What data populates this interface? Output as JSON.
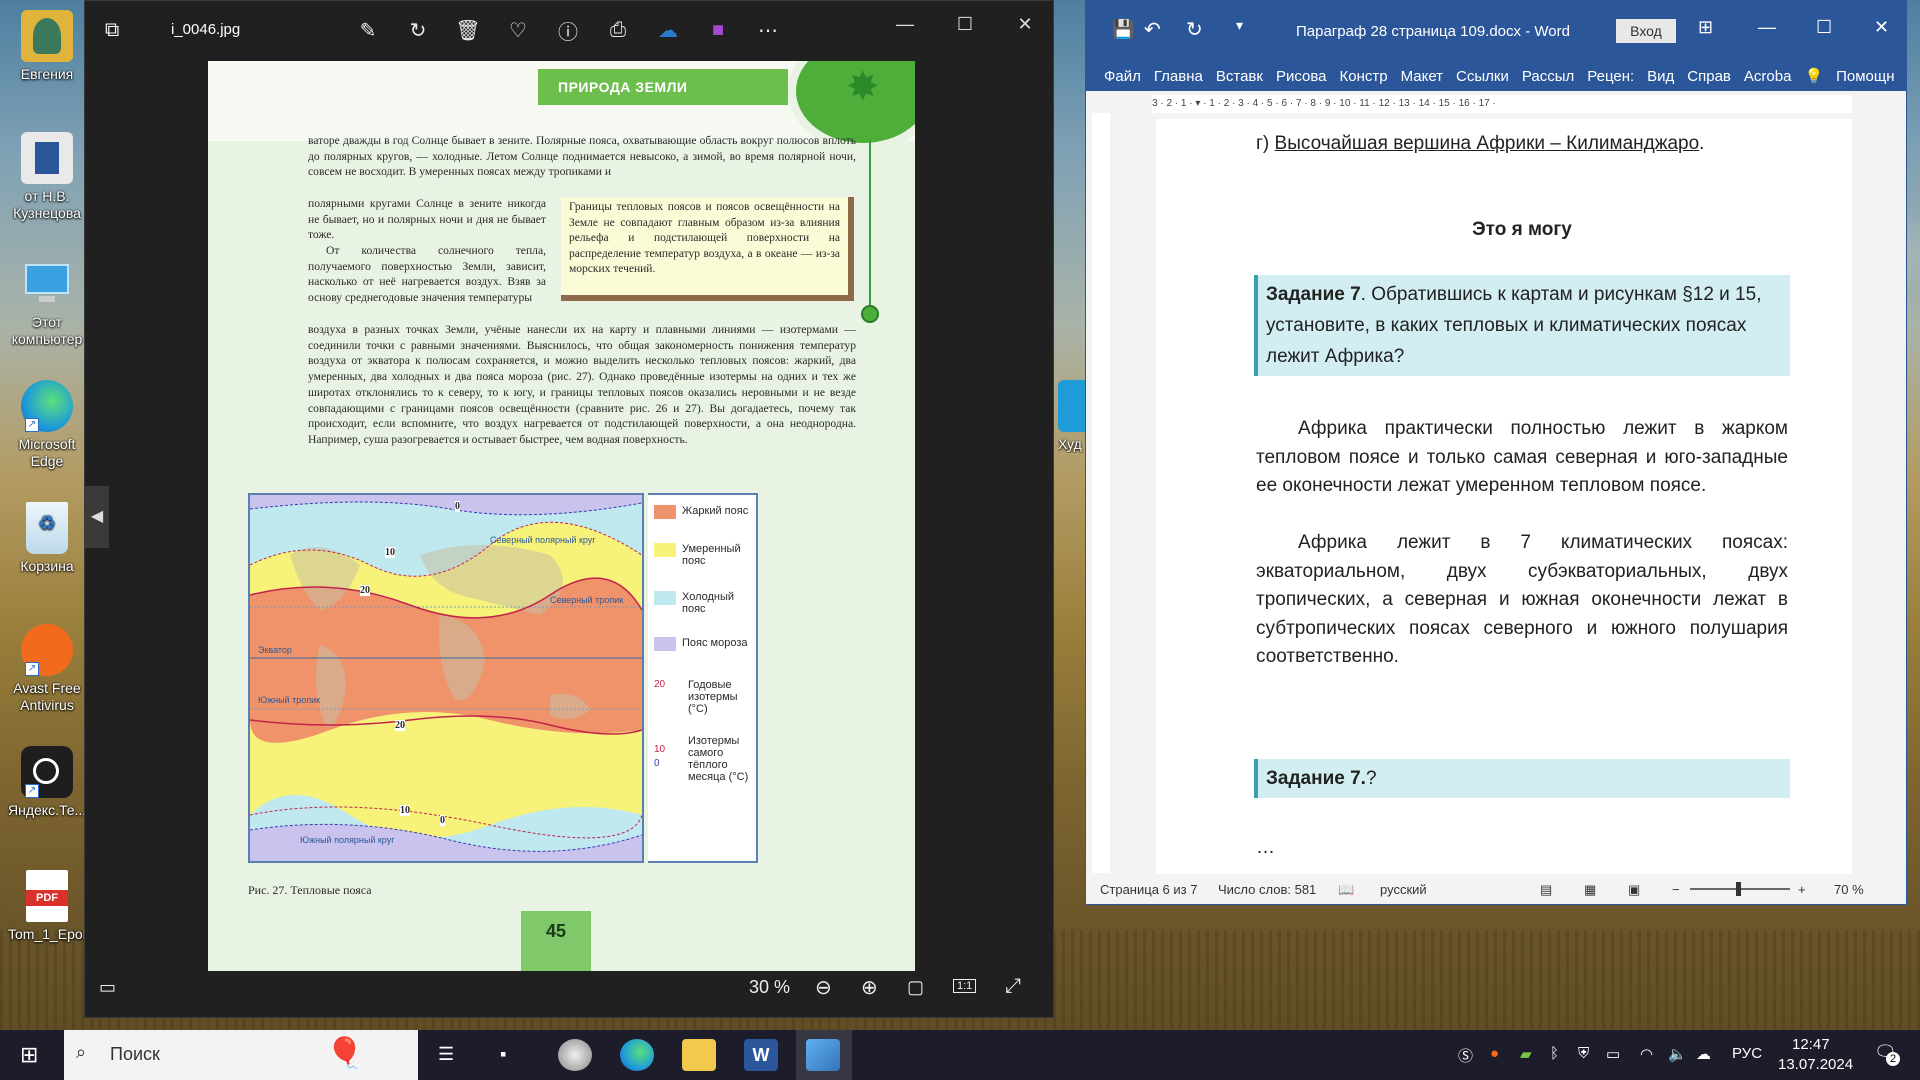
{
  "desktop": {
    "icons": [
      {
        "label": "Евгения",
        "color": "#e0b43a"
      },
      {
        "label": "от Н.В.\nКузнецова",
        "color": "#e9e9e9"
      },
      {
        "label": "Этот\nкомпьютер",
        "color": "#3aa0e0"
      },
      {
        "label": "Microsoft\nEdge",
        "color": "#1f9bd8"
      },
      {
        "label": "Корзина",
        "color": "#cfe8f5"
      },
      {
        "label": "Avast Free\nAntivirus",
        "color": "#f26b1d"
      },
      {
        "label": "Яндекс.Те...",
        "color": "#1e1e1e"
      },
      {
        "label": "Tom_1_Epok",
        "color": "#d9312b"
      }
    ],
    "partial_icon_label": "Худ"
  },
  "photos": {
    "title": "i_0046.jpg",
    "zoom": "30 %",
    "ratio_label": "1:1",
    "page": {
      "header": "ПРИРОДА ЗЕМЛИ",
      "para1": "ваторе дважды в год Солнце бывает в зените. Полярные пояса, охватывающие область вокруг полюсов вплоть до полярных кругов, — холодные. Летом Солнце поднимается невысоко, а зимой, во время полярной ночи, совсем не восходит. В умеренных поясах между тропиками и",
      "para2": "полярными кругами Солнце в зените никогда не бывает, но и полярных ночи и дня не бывает тоже.",
      "para3": "От количества солнечного тепла, получаемого поверхностью Земли, зависит, насколько от неё нагревается воздух. Взяв за основу среднегодовые значения температуры",
      "callout": "Границы тепловых поясов и поясов освещённости на Земле не совпадают главным образом из-за влияния рельефа и подстилающей поверхности на распределение температур воздуха, а в океане — из-за морских течений.",
      "para4": "воздуха в разных точках Земли, учёные нанесли их на карту и плавными линиями — изотермами — соединили точки с равными значениями. Выяснилось, что общая закономерность понижения температур воздуха от экватора к полюсам сохраняется, и можно выделить несколько тепловых поясов: жаркий, два умеренных, два холодных и два пояса мороза (рис. 27). Однако проведённые изотермы на одних и тех же широтах отклонялись то к северу, то к югу, и границы тепловых поясов оказались неровными и не везде совпадающими с границами поясов освещённости (сравните рис. 26 и 27). Вы догадаетесь, почему так происходит, если вспомните, что воздух нагревается от подстилающей поверхности, а она неоднородна. Например, суша разогревается и остывает быстрее, чем водная поверхность.",
      "map_labels": {
        "arctic": "Северный полярный круг",
        "tropic_n": "Северный тропик",
        "equator": "Экватор",
        "tropic_s": "Южный тропик",
        "antarctic": "Южный полярный круг",
        "iso_0": "0",
        "iso_10": "10",
        "iso_20": "20"
      },
      "legend": [
        {
          "label": "Жаркий пояс",
          "color": "#f0936a"
        },
        {
          "label": "Умеренный пояс",
          "color": "#f7f27a"
        },
        {
          "label": "Холодный пояс",
          "color": "#bfe9ef"
        },
        {
          "label": "Пояс мороза",
          "color": "#c9c3ee"
        },
        {
          "label": "Годовые изотермы (°С)",
          "value": "20"
        },
        {
          "label": "Изотермы самого тёплого месяца (°С)",
          "value_a": "10",
          "value_b": "0"
        }
      ],
      "caption": "Рис. 27. Тепловые пояса",
      "number": "45"
    }
  },
  "word": {
    "title": "Параграф 28 страница 109.docx  -  Word",
    "signin": "Вход",
    "tabs": [
      "Файл",
      "Главна",
      "Вставк",
      "Рисова",
      "Констр",
      "Макет",
      "Ссылки",
      "Рассыл",
      "Рецен:",
      "Вид",
      "Справ",
      "Acroba",
      "Помощн"
    ],
    "ruler": "3 · 2 · 1 · ▾ · 1 · 2 · 3 · 4 · 5 · 6 · 7 · 8 · 9 · 10 · 11 · 12 · 13 · 14 · 15 · 16 · 17 ·",
    "doc": {
      "line_top_prefix": "г) ",
      "line_top": "Высочайшая вершина Африки – Килиманджаро",
      "line_top_suffix": ".",
      "heading": "Это я могу",
      "task1_bold": "Задание 7",
      "task1_text": ". Обратившись к картам и рисункам §12 и 15, установите, в каких тепловых и климатических поясах лежит Африка?",
      "para1": "Африка практически полностью лежит в жарком тепловом поясе и только самая северная и юго-западные ее оконечности лежат умеренном тепловом поясе.",
      "para2": "Африка лежит в 7 климатических поясах: экваториальном, двух субэкваториальных, двух тропических, а северная и южная оконечности лежат в субтропических поясах северного и южного полушария соответственно.",
      "task2_bold": "Задание 7.",
      "task2_text": "?",
      "ellipsis": "…"
    },
    "status": {
      "page": "Страница 6 из 7",
      "words": "Число слов: 581",
      "lang": "русский",
      "zoom": "70 %"
    }
  },
  "taskbar": {
    "search": "Поиск",
    "lang": "РУС",
    "time": "12:47",
    "date": "13.07.2024",
    "notifications": "2"
  }
}
